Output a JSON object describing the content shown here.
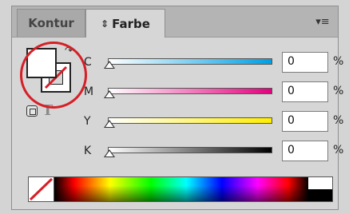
{
  "panel": {
    "tabs": [
      {
        "label": "Kontur",
        "active": false
      },
      {
        "label": "Farbe",
        "active": true,
        "icon": "updown-arrows-icon"
      }
    ],
    "menu_icon": "panel-menu-icon"
  },
  "swatch": {
    "fill_color": "#ffffff",
    "stroke": "none",
    "highlight_circle_color": "#d61f26",
    "swap_icon": "swap-arrow-icon",
    "format_text_glyph": "T"
  },
  "sliders": [
    {
      "letter": "C",
      "value": "0",
      "unit": "%",
      "gradient_start": "#ffffff",
      "gradient_end": "#009fe3",
      "level": 0
    },
    {
      "letter": "M",
      "value": "0",
      "unit": "%",
      "gradient_start": "#ffffff",
      "gradient_end": "#e5007e",
      "level": 0
    },
    {
      "letter": "Y",
      "value": "0",
      "unit": "%",
      "gradient_start": "#ffffff",
      "gradient_end": "#ffed00",
      "level": 0
    },
    {
      "letter": "K",
      "value": "0",
      "unit": "%",
      "gradient_start": "#ffffff",
      "gradient_end": "#000000",
      "level": 0
    }
  ],
  "spectrum": {
    "none_swatch_line_color": "#d61f26"
  }
}
